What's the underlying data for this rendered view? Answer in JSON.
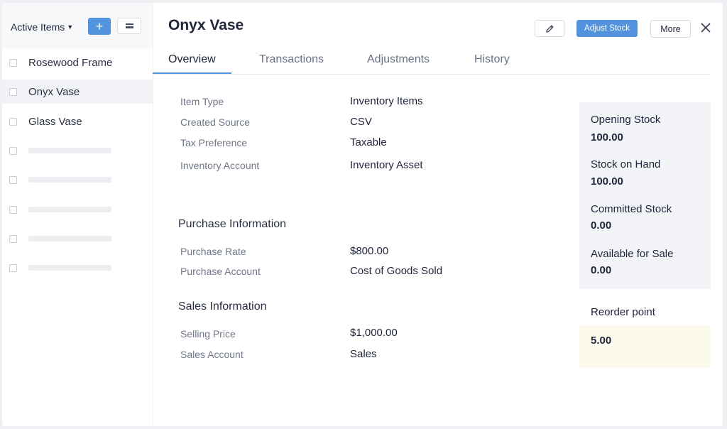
{
  "sidebar": {
    "filter_label": "Active Items",
    "add_label": "+",
    "items": [
      {
        "name": "Rosewood Frame"
      },
      {
        "name": "Onyx Vase"
      },
      {
        "name": "Glass Vase"
      }
    ]
  },
  "header": {
    "title": "Onyx Vase",
    "adjust_stock_label": "Adjust Stock",
    "more_label": "More"
  },
  "tabs": [
    "Overview",
    "Transactions",
    "Adjustments",
    "History"
  ],
  "overview": {
    "details": [
      {
        "label": "Item Type",
        "value": "Inventory Items"
      },
      {
        "label": "Created Source",
        "value": "CSV"
      },
      {
        "label": "Tax Preference",
        "value": "Taxable"
      },
      {
        "label": "Inventory Account",
        "value": "Inventory Asset"
      }
    ],
    "purchase": {
      "heading": "Purchase Information",
      "rows": [
        {
          "label": "Purchase Rate",
          "value": "$800.00"
        },
        {
          "label": "Purchase Account",
          "value": "Cost of Goods Sold"
        }
      ]
    },
    "sales": {
      "heading": "Sales Information",
      "rows": [
        {
          "label": "Selling Price",
          "value": "$1,000.00"
        },
        {
          "label": "Sales Account",
          "value": "Sales"
        }
      ]
    }
  },
  "stock": [
    {
      "label": "Opening Stock",
      "value": "100.00"
    },
    {
      "label": "Stock on Hand",
      "value": "100.00"
    },
    {
      "label": "Committed Stock",
      "value": "0.00"
    },
    {
      "label": "Available for Sale",
      "value": "0.00"
    }
  ],
  "reorder": {
    "label": "Reorder point",
    "value": "5.00"
  },
  "colors": {
    "accent": "#5193dc",
    "reorder_bg": "#fcfaeb",
    "panel_bg": "#f3f4f7"
  }
}
